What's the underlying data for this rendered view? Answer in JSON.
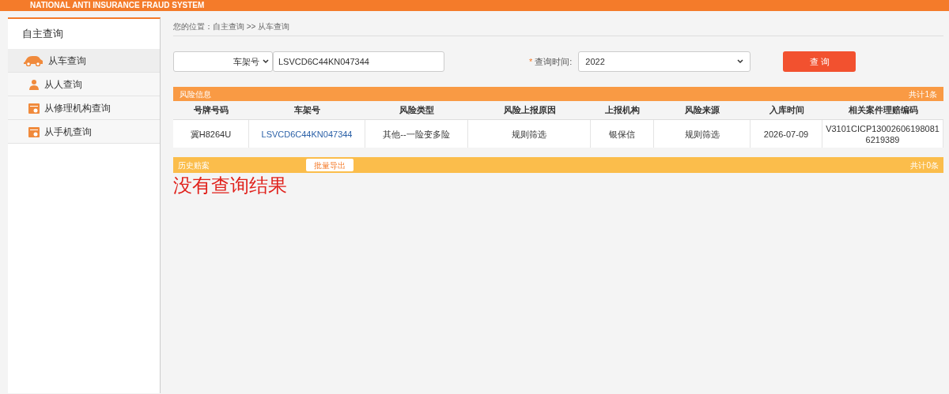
{
  "header": {
    "subtitle": "NATIONAL ANTI INSURANCE FRAUD SYSTEM"
  },
  "sidebar": {
    "title": "自主查询",
    "items": [
      {
        "label": "从车查询",
        "kind": "car",
        "selected": true
      },
      {
        "label": "从人查询",
        "kind": "person",
        "selected": false
      },
      {
        "label": "从修理机构查询",
        "kind": "calendar",
        "selected": false
      },
      {
        "label": "从手机查询",
        "kind": "calendar",
        "selected": false
      }
    ]
  },
  "breadcrumb": "您的位置：自主查询 >> 从车查询",
  "search": {
    "type_select": "车架号",
    "value": "LSVCD6C44KN047344",
    "time_label": "查询时间:",
    "required_mark": "*",
    "time_select": "2022",
    "button": "查 询"
  },
  "risk": {
    "title": "风险信息",
    "count": "共计1条",
    "columns": [
      "号牌号码",
      "车架号",
      "风险类型",
      "风险上报原因",
      "上报机构",
      "风险来源",
      "入库时间",
      "相关案件理赔编码"
    ],
    "rows": [
      [
        "冀H8264U",
        "LSVCD6C44KN047344",
        "其他--一险变多险",
        "规则筛选",
        "银保信",
        "规则筛选",
        "2026-07-09",
        "V3101CICP130026061980816219389"
      ]
    ]
  },
  "history": {
    "title": "历史赔案",
    "export_button": "批量导出",
    "count": "共计0条",
    "empty": "没有查询结果"
  }
}
